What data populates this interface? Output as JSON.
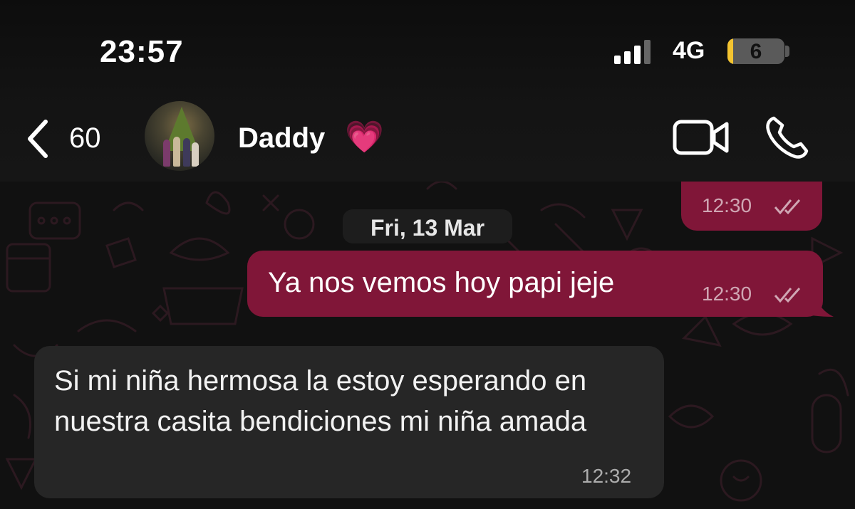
{
  "status_bar": {
    "time": "23:57",
    "network": "4G",
    "battery_level": "6"
  },
  "header": {
    "back_count": "60",
    "contact_name": "Daddy",
    "name_emoji": "💗",
    "icons": [
      "back-chevron-icon",
      "video-call-icon",
      "phone-call-icon"
    ]
  },
  "chat": {
    "date_separator": "Fri, 13 Mar",
    "messages": [
      {
        "direction": "outgoing",
        "text": "",
        "time": "12:30",
        "status": "read"
      },
      {
        "direction": "outgoing",
        "text": "Ya nos vemos hoy papi jeje",
        "time": "12:30",
        "status": "read"
      },
      {
        "direction": "incoming",
        "text": "Si mi niña hermosa la estoy esperando en nuestra casita bendiciones mi niña amada",
        "time": "12:32"
      }
    ]
  },
  "colors": {
    "outgoing_bubble": "#801638",
    "incoming_bubble": "#262626",
    "background": "#111111",
    "wallpaper_doodle": "#2a1a1f"
  }
}
